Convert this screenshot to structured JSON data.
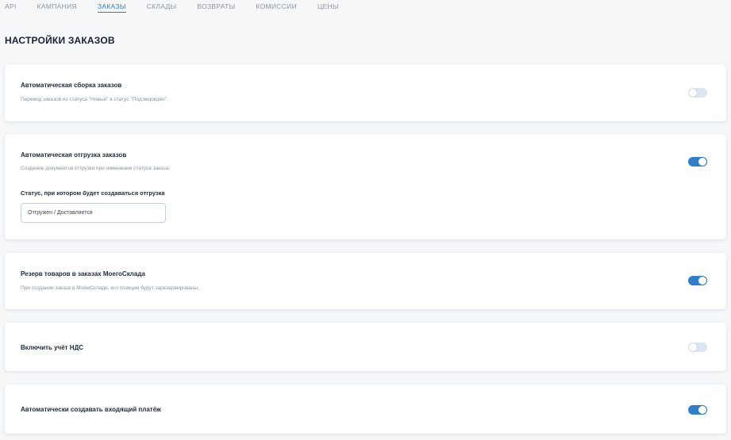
{
  "tabs": [
    {
      "label": "API",
      "active": false
    },
    {
      "label": "КАМПАНИЯ",
      "active": false
    },
    {
      "label": "ЗАКАЗЫ",
      "active": true
    },
    {
      "label": "СКЛАДЫ",
      "active": false
    },
    {
      "label": "ВОЗВРАТЫ",
      "active": false
    },
    {
      "label": "КОМИССИИ",
      "active": false
    },
    {
      "label": "ЦЕНЫ",
      "active": false
    }
  ],
  "page_title": "НАСТРОЙКИ ЗАКАЗОВ",
  "cards": {
    "auto_assembly": {
      "title": "Автоматическая сборка заказов",
      "description": "Перевод заказов из статуса \"Новый\" в статус \"Подтверждён\".",
      "enabled": false
    },
    "auto_shipment": {
      "title": "Автоматическая отгрузка заказов",
      "description": "Создание документов отгрузки при изменении статуса заказа.",
      "enabled": true,
      "status_label": "Статус, при котором будет создаваться отгрузка",
      "status_value": "Отгружен / Доставляется"
    },
    "reserve": {
      "title": "Резерв товаров в заказах МоегоСклада",
      "description": "При создании заказа в МоёмСкладе, его позиции будут зарезервированы.",
      "enabled": true
    },
    "vat": {
      "title": "Включить учёт НДС",
      "enabled": false
    },
    "incoming_payment": {
      "title": "Автоматически создавать входящий платёж",
      "enabled": true
    }
  },
  "colors": {
    "accent": "#2f7fcc",
    "toggle_off": "#dbe4f2"
  }
}
